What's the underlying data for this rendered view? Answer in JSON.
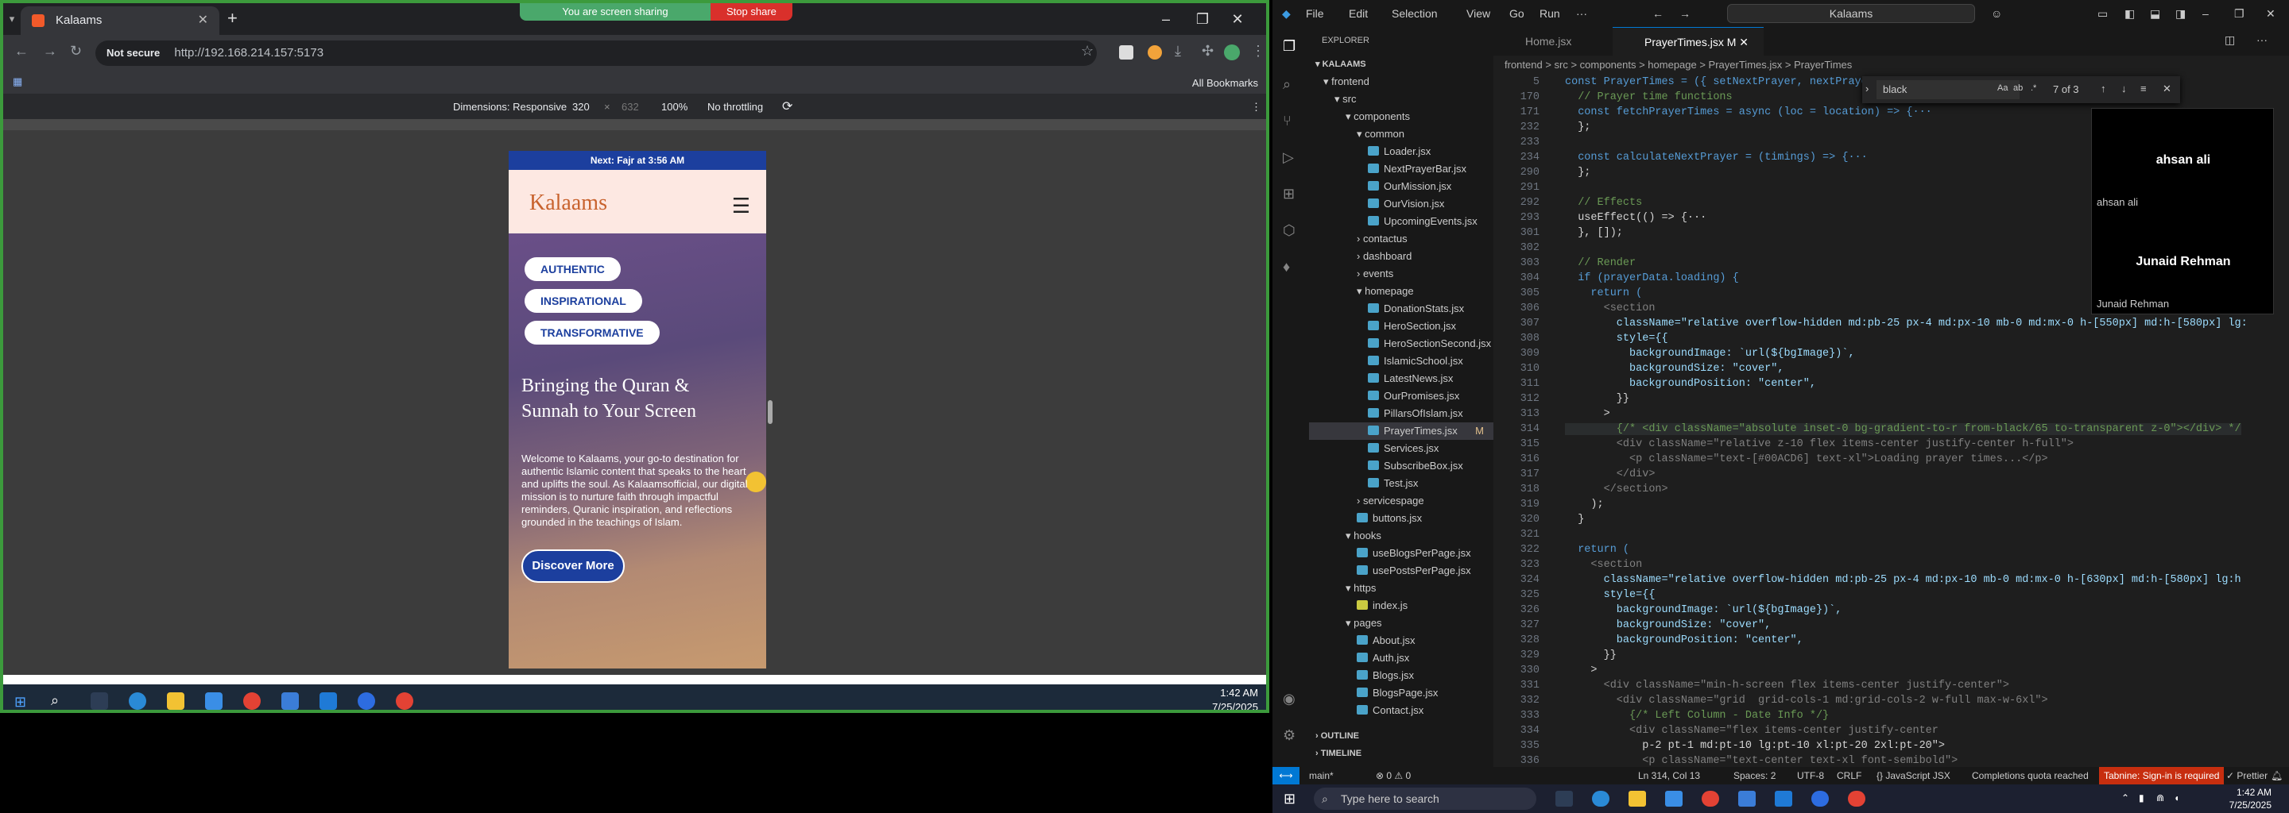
{
  "browser": {
    "tab_title": "Kalaams",
    "share_text": "You are screen sharing",
    "stop_share": "Stop share",
    "not_secure": "Not secure",
    "url": "http://192.168.214.157:5173",
    "all_bookmarks": "All Bookmarks",
    "device_toolbar": {
      "dimensions": "Dimensions: Responsive",
      "width": "320",
      "x": "×",
      "height": "632",
      "zoom": "100%",
      "throttle": "No throttling"
    }
  },
  "mobile": {
    "next_prayer": "Next: Fajr at 3:56 AM",
    "logo": "Kalaams",
    "pills": [
      "AUTHENTIC",
      "INSPIRATIONAL",
      "TRANSFORMATIVE"
    ],
    "title": "Bringing the Quran & Sunnah to Your Screen",
    "description": "Welcome to Kalaams, your go-to destination for authentic Islamic content that speaks to the heart and uplifts the soul. As Kalaamsofficial, our digital mission is to nurture faith through impactful reminders, Quranic inspiration, and reflections grounded in the teachings of Islam.",
    "cta": "Discover More"
  },
  "left_clock": {
    "time": "1:42 AM",
    "date": "7/25/2025"
  },
  "vscode": {
    "menu": [
      "File",
      "Edit",
      "Selection",
      "View",
      "Go",
      "Run",
      "···"
    ],
    "search": "Kalaams",
    "explorer_title": "EXPLORER",
    "root": "KALAAMS",
    "tree": [
      {
        "label": "frontend",
        "indent": 1,
        "type": "folder-open"
      },
      {
        "label": "src",
        "indent": 2,
        "type": "folder-open"
      },
      {
        "label": "components",
        "indent": 3,
        "type": "folder-open"
      },
      {
        "label": "common",
        "indent": 4,
        "type": "folder-open"
      },
      {
        "label": "Loader.jsx",
        "indent": 5,
        "type": "file"
      },
      {
        "label": "NextPrayerBar.jsx",
        "indent": 5,
        "type": "file"
      },
      {
        "label": "OurMission.jsx",
        "indent": 5,
        "type": "file"
      },
      {
        "label": "OurVision.jsx",
        "indent": 5,
        "type": "file"
      },
      {
        "label": "UpcomingEvents.jsx",
        "indent": 5,
        "type": "file"
      },
      {
        "label": "contactus",
        "indent": 4,
        "type": "folder"
      },
      {
        "label": "dashboard",
        "indent": 4,
        "type": "folder"
      },
      {
        "label": "events",
        "indent": 4,
        "type": "folder"
      },
      {
        "label": "homepage",
        "indent": 4,
        "type": "folder-open"
      },
      {
        "label": "DonationStats.jsx",
        "indent": 5,
        "type": "file"
      },
      {
        "label": "HeroSection.jsx",
        "indent": 5,
        "type": "file"
      },
      {
        "label": "HeroSectionSecond.jsx",
        "indent": 5,
        "type": "file"
      },
      {
        "label": "IslamicSchool.jsx",
        "indent": 5,
        "type": "file"
      },
      {
        "label": "LatestNews.jsx",
        "indent": 5,
        "type": "file"
      },
      {
        "label": "OurPromises.jsx",
        "indent": 5,
        "type": "file"
      },
      {
        "label": "PillarsOfIslam.jsx",
        "indent": 5,
        "type": "file"
      },
      {
        "label": "PrayerTimes.jsx",
        "indent": 5,
        "type": "file",
        "selected": true,
        "badge": "M"
      },
      {
        "label": "Services.jsx",
        "indent": 5,
        "type": "file"
      },
      {
        "label": "SubscribeBox.jsx",
        "indent": 5,
        "type": "file"
      },
      {
        "label": "Test.jsx",
        "indent": 5,
        "type": "file"
      },
      {
        "label": "servicespage",
        "indent": 4,
        "type": "folder"
      },
      {
        "label": "buttons.jsx",
        "indent": 4,
        "type": "file"
      },
      {
        "label": "hooks",
        "indent": 3,
        "type": "folder-open"
      },
      {
        "label": "useBlogsPerPage.jsx",
        "indent": 4,
        "type": "file"
      },
      {
        "label": "usePostsPerPage.jsx",
        "indent": 4,
        "type": "file"
      },
      {
        "label": "https",
        "indent": 3,
        "type": "folder-open"
      },
      {
        "label": "index.js",
        "indent": 4,
        "type": "file"
      },
      {
        "label": "pages",
        "indent": 3,
        "type": "folder-open"
      },
      {
        "label": "About.jsx",
        "indent": 4,
        "type": "file"
      },
      {
        "label": "Auth.jsx",
        "indent": 4,
        "type": "file"
      },
      {
        "label": "Blogs.jsx",
        "indent": 4,
        "type": "file"
      },
      {
        "label": "BlogsPage.jsx",
        "indent": 4,
        "type": "file"
      },
      {
        "label": "Contact.jsx",
        "indent": 4,
        "type": "file"
      }
    ],
    "outline": "OUTLINE",
    "timeline": "TIMELINE",
    "tabs": [
      "Home.jsx",
      "PrayerTimes.jsx M"
    ],
    "breadcrumb": "frontend > src > components > homepage > PrayerTimes.jsx > PrayerTimes",
    "find": {
      "query": "black",
      "count": "7 of 3"
    },
    "code": [
      {
        "n": "5",
        "t": "const PrayerTimes = ({ setNextPrayer, nextPrayer"
      },
      {
        "n": "170",
        "t": "  // Prayer time functions"
      },
      {
        "n": "171",
        "t": "  const fetchPrayerTimes = async (loc = location) => {···"
      },
      {
        "n": "232",
        "t": "  };"
      },
      {
        "n": "233",
        "t": ""
      },
      {
        "n": "234",
        "t": "  const calculateNextPrayer = (timings) => {···"
      },
      {
        "n": "290",
        "t": "  };"
      },
      {
        "n": "291",
        "t": ""
      },
      {
        "n": "292",
        "t": "  // Effects"
      },
      {
        "n": "293",
        "t": "  useEffect(() => {···"
      },
      {
        "n": "301",
        "t": "  }, []);"
      },
      {
        "n": "302",
        "t": ""
      },
      {
        "n": "303",
        "t": "  // Render"
      },
      {
        "n": "304",
        "t": "  if (prayerData.loading) {"
      },
      {
        "n": "305",
        "t": "    return ("
      },
      {
        "n": "306",
        "t": "      <section"
      },
      {
        "n": "307",
        "t": "        className=\"relative overflow-hidden md:pb-25 px-4 md:px-10 mb-0 md:mx-0 h-[550px] md:h-[580px] lg:"
      },
      {
        "n": "308",
        "t": "        style={{"
      },
      {
        "n": "309",
        "t": "          backgroundImage: `url(${bgImage})`,"
      },
      {
        "n": "310",
        "t": "          backgroundSize: \"cover\","
      },
      {
        "n": "311",
        "t": "          backgroundPosition: \"center\","
      },
      {
        "n": "312",
        "t": "        }}"
      },
      {
        "n": "313",
        "t": "      >"
      },
      {
        "n": "314",
        "t": "        {/* <div className=\"absolute inset-0 bg-gradient-to-r from-black/65 to-transparent z-0\"></div> */"
      },
      {
        "n": "315",
        "t": "        <div className=\"relative z-10 flex items-center justify-center h-full\">"
      },
      {
        "n": "316",
        "t": "          <p className=\"text-[#00ACD6] text-xl\">Loading prayer times...</p>"
      },
      {
        "n": "317",
        "t": "        </div>"
      },
      {
        "n": "318",
        "t": "      </section>"
      },
      {
        "n": "319",
        "t": "    );"
      },
      {
        "n": "320",
        "t": "  }"
      },
      {
        "n": "321",
        "t": ""
      },
      {
        "n": "322",
        "t": "  return ("
      },
      {
        "n": "323",
        "t": "    <section"
      },
      {
        "n": "324",
        "t": "      className=\"relative overflow-hidden md:pb-25 px-4 md:px-10 mb-0 md:mx-0 h-[630px] md:h-[580px] lg:h"
      },
      {
        "n": "325",
        "t": "      style={{"
      },
      {
        "n": "326",
        "t": "        backgroundImage: `url(${bgImage})`,"
      },
      {
        "n": "327",
        "t": "        backgroundSize: \"cover\","
      },
      {
        "n": "328",
        "t": "        backgroundPosition: \"center\","
      },
      {
        "n": "329",
        "t": "      }}"
      },
      {
        "n": "330",
        "t": "    >"
      },
      {
        "n": "331",
        "t": "      <div className=\"min-h-screen flex items-center justify-center\">"
      },
      {
        "n": "332",
        "t": "        <div className=\"grid  grid-cols-1 md:grid-cols-2 w-full max-w-6xl\">"
      },
      {
        "n": "333",
        "t": "          {/* Left Column - Date Info */}"
      },
      {
        "n": "334",
        "t": "          <div className=\"flex items-center justify-center"
      },
      {
        "n": "335",
        "t": "            p-2 pt-1 md:pt-10 lg:pt-10 xl:pt-20 2xl:pt-20\">"
      },
      {
        "n": "336",
        "t": "            <p className=\"text-center text-xl font-semibold\">"
      }
    ],
    "participants": [
      "ahsan ali",
      "Junaid Rehman"
    ],
    "status": {
      "branch": "main*",
      "problems": "⊗ 0 ⚠ 0",
      "position": "Ln 314, Col 13",
      "spaces": "Spaces: 2",
      "encoding": "UTF-8",
      "eol": "CRLF",
      "lang": "{} JavaScript JSX",
      "quota": "Completions quota reached",
      "tabnine": "Tabnine: Sign-in is required",
      "prettier": "✓ Prettier"
    }
  },
  "windows": {
    "search_placeholder": "Type here to search",
    "time": "1:42 AM",
    "date": "7/25/2025"
  }
}
